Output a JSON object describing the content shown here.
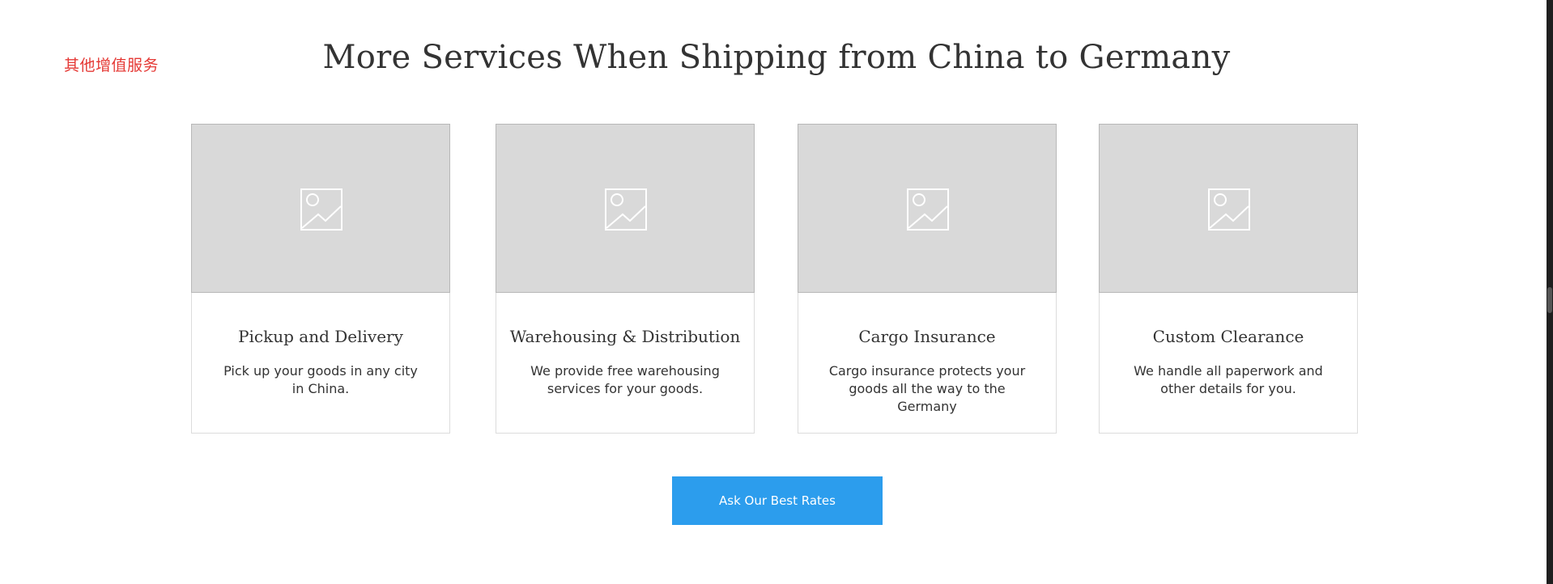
{
  "note": {
    "label": "其他增值服务",
    "color": "#e53935"
  },
  "section": {
    "title": "More Services When Shipping from China to Germany"
  },
  "cards": [
    {
      "image_icon": "image-placeholder-icon",
      "title": "Pickup and Delivery",
      "description": "Pick up your goods in any city in China."
    },
    {
      "image_icon": "image-placeholder-icon",
      "title": "Warehousing & Distribution",
      "description": "We provide free warehousing services for your goods."
    },
    {
      "image_icon": "image-placeholder-icon",
      "title": "Cargo Insurance",
      "description": "Cargo insurance protects your goods all the way to the Germany"
    },
    {
      "image_icon": "image-placeholder-icon",
      "title": "Custom Clearance",
      "description": "We handle all paperwork and other details for you."
    }
  ],
  "cta": {
    "label": "Ask Our Best Rates",
    "color": "#2c9ded"
  }
}
